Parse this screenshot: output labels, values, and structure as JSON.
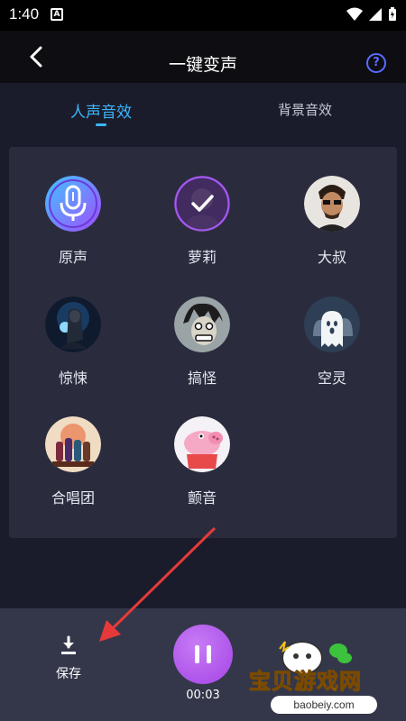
{
  "status": {
    "time": "1:40",
    "badge": "A"
  },
  "header": {
    "title": "一键变声",
    "help": "?"
  },
  "tabs": [
    {
      "label": "人声音效",
      "active": true
    },
    {
      "label": "背景音效",
      "active": false
    }
  ],
  "effects": [
    {
      "label": "原声",
      "icon": "microphone-icon"
    },
    {
      "label": "萝莉",
      "icon": "loli-avatar"
    },
    {
      "label": "大叔",
      "icon": "uncle-avatar"
    },
    {
      "label": "惊悚",
      "icon": "thriller-avatar"
    },
    {
      "label": "搞怪",
      "icon": "funny-avatar"
    },
    {
      "label": "空灵",
      "icon": "ghost-avatar"
    },
    {
      "label": "合唱团",
      "icon": "choir-avatar"
    },
    {
      "label": "颤音",
      "icon": "pig-avatar"
    }
  ],
  "selected_effect": "萝莉",
  "bottom": {
    "save_label": "保存",
    "time": "00:03"
  },
  "watermark": {
    "text": "宝贝游戏网",
    "url": "baobeiy.com"
  },
  "colors": {
    "accent": "#3ab7ff",
    "play": "#b45aee",
    "arrow": "#e63a3a"
  }
}
